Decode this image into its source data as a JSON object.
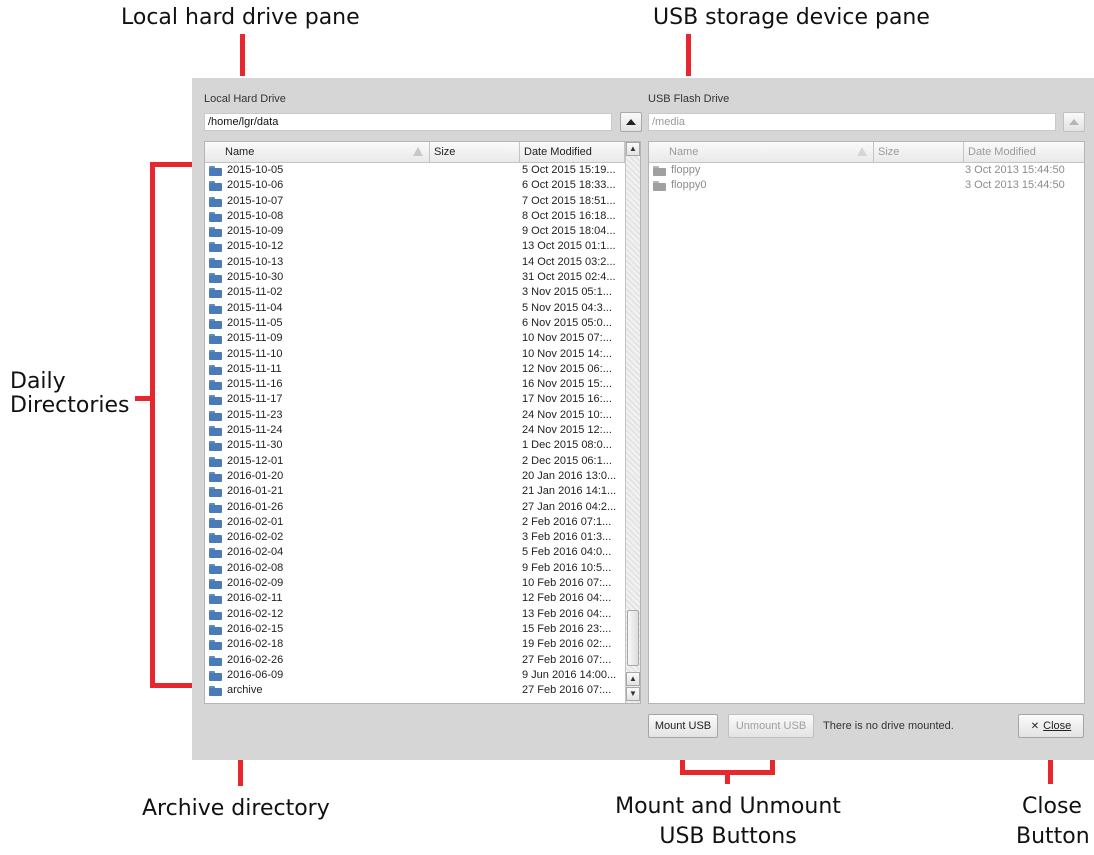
{
  "annotations": {
    "local_pane": "Local hard drive pane",
    "usb_pane": "USB storage device pane",
    "daily_line1": "Daily",
    "daily_line2": "Directories",
    "archive": "Archive directory",
    "mount_line1": "Mount and Unmount",
    "mount_line2": "USB Buttons",
    "close_line1": "Close",
    "close_line2": "Button"
  },
  "local": {
    "label": "Local Hard Drive",
    "path": "/home/lgr/data",
    "columns": {
      "name": "Name",
      "size": "Size",
      "date": "Date Modified"
    },
    "rows": [
      {
        "name": "2015-10-05",
        "date": "5 Oct 2015 15:19..."
      },
      {
        "name": "2015-10-06",
        "date": "6 Oct 2015 18:33..."
      },
      {
        "name": "2015-10-07",
        "date": "7 Oct 2015 18:51..."
      },
      {
        "name": "2015-10-08",
        "date": "8 Oct 2015 16:18..."
      },
      {
        "name": "2015-10-09",
        "date": "9 Oct 2015 18:04..."
      },
      {
        "name": "2015-10-12",
        "date": "13 Oct 2015 01:1..."
      },
      {
        "name": "2015-10-13",
        "date": "14 Oct 2015 03:2..."
      },
      {
        "name": "2015-10-30",
        "date": "31 Oct 2015 02:4..."
      },
      {
        "name": "2015-11-02",
        "date": "3 Nov 2015 05:1..."
      },
      {
        "name": "2015-11-04",
        "date": "5 Nov 2015 04:3..."
      },
      {
        "name": "2015-11-05",
        "date": "6 Nov 2015 05:0..."
      },
      {
        "name": "2015-11-09",
        "date": "10 Nov 2015 07:..."
      },
      {
        "name": "2015-11-10",
        "date": "10 Nov 2015 14:..."
      },
      {
        "name": "2015-11-11",
        "date": "12 Nov 2015 06:..."
      },
      {
        "name": "2015-11-16",
        "date": "16 Nov 2015 15:..."
      },
      {
        "name": "2015-11-17",
        "date": "17 Nov 2015 16:..."
      },
      {
        "name": "2015-11-23",
        "date": "24 Nov 2015 10:..."
      },
      {
        "name": "2015-11-24",
        "date": "24 Nov 2015 12:..."
      },
      {
        "name": "2015-11-30",
        "date": "1 Dec 2015 08:0..."
      },
      {
        "name": "2015-12-01",
        "date": "2 Dec 2015 06:1..."
      },
      {
        "name": "2016-01-20",
        "date": "20 Jan 2016 13:0..."
      },
      {
        "name": "2016-01-21",
        "date": "21 Jan 2016 14:1..."
      },
      {
        "name": "2016-01-26",
        "date": "27 Jan 2016 04:2..."
      },
      {
        "name": "2016-02-01",
        "date": "2 Feb 2016 07:1..."
      },
      {
        "name": "2016-02-02",
        "date": "3 Feb 2016 01:3..."
      },
      {
        "name": "2016-02-04",
        "date": "5 Feb 2016 04:0..."
      },
      {
        "name": "2016-02-08",
        "date": "9 Feb 2016 10:5..."
      },
      {
        "name": "2016-02-09",
        "date": "10 Feb 2016 07:..."
      },
      {
        "name": "2016-02-11",
        "date": "12 Feb 2016 04:..."
      },
      {
        "name": "2016-02-12",
        "date": "13 Feb 2016 04:..."
      },
      {
        "name": "2016-02-15",
        "date": "15 Feb 2016 23:..."
      },
      {
        "name": "2016-02-18",
        "date": "19 Feb 2016 02:..."
      },
      {
        "name": "2016-02-26",
        "date": "27 Feb 2016 07:..."
      },
      {
        "name": "2016-06-09",
        "date": "9 Jun 2016 14:00..."
      },
      {
        "name": "archive",
        "date": "27 Feb 2016 07:..."
      }
    ]
  },
  "usb": {
    "label": "USB Flash Drive",
    "path": "/media",
    "columns": {
      "name": "Name",
      "size": "Size",
      "date": "Date Modified"
    },
    "rows": [
      {
        "name": "floppy",
        "date": "3 Oct 2013 15:44:50"
      },
      {
        "name": "floppy0",
        "date": "3 Oct 2013 15:44:50"
      }
    ]
  },
  "buttons": {
    "mount": "Mount USB",
    "unmount": "Unmount USB",
    "close": "Close",
    "close_glyph": "✕"
  },
  "status": "There is no drive mounted.",
  "colors": {
    "annotation_red": "#e8262e",
    "folder_blue": "#4a7bb8"
  }
}
